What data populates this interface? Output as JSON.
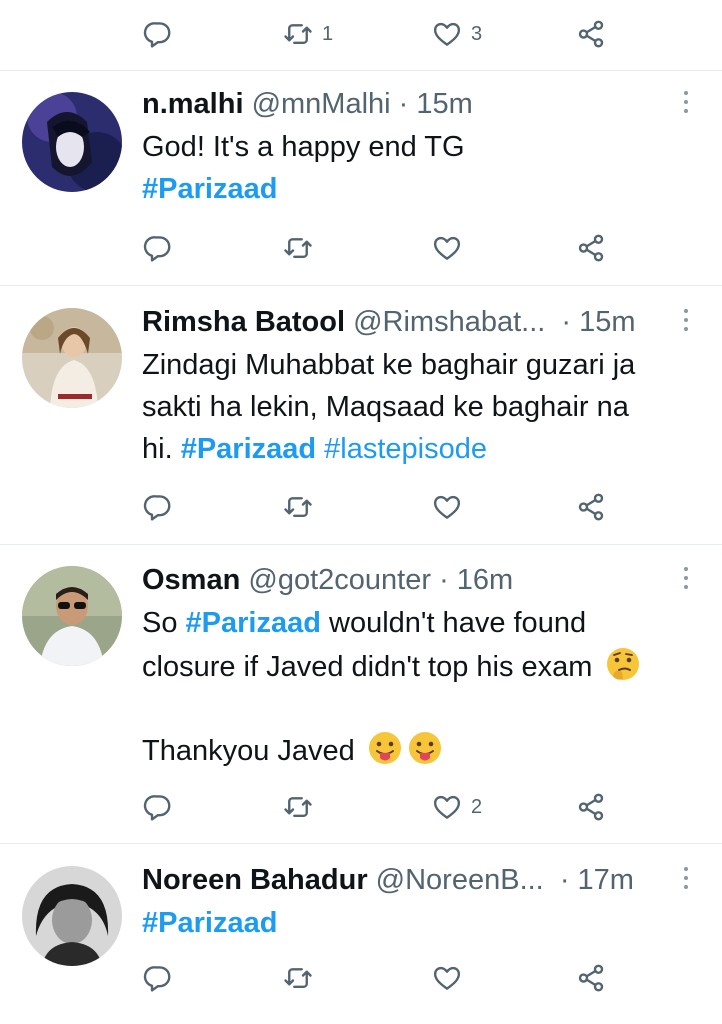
{
  "top_actions": {
    "retweets": "1",
    "likes": "3"
  },
  "tweets": [
    {
      "name": "n.malhi",
      "handle": "@mnMalhi",
      "dot": "·",
      "time": "15m",
      "text1": "God! It's a happy end TG",
      "hashtag1": "#Parizaad",
      "retweets": "",
      "likes": ""
    },
    {
      "name": "Rimsha Batool",
      "handle": "@Rimshabat...",
      "dot": "·",
      "time": "15m",
      "line1": "Zindagi Muhabbat ke baghair guzari ja",
      "line2": "sakti ha lekin, Maqsaad ke baghair na",
      "line3_pre": "hi. ",
      "hashtag1": "#Parizaad",
      "hashtag2": "#lastepisode"
    },
    {
      "name": "Osman",
      "handle": "@got2counter",
      "dot": "·",
      "time": "16m",
      "line1_pre": "So ",
      "hashtag1": "#Parizaad",
      "line1_post": " wouldn't have found",
      "line2": "closure if Javed didn't top his exam",
      "line3": "Thankyou Javed",
      "likes": "2"
    },
    {
      "name": "Noreen Bahadur",
      "handle": "@NoreenB...",
      "dot": "·",
      "time": "17m",
      "hashtag1": "#Parizaad"
    }
  ],
  "icons": {
    "reply": "reply-icon",
    "retweet": "retweet-icon",
    "like": "heart-icon",
    "share": "share-icon",
    "more": "more-icon"
  },
  "colors": {
    "hashtag": "#1d9bf0",
    "muted": "#536471",
    "text": "#0f1419",
    "divider": "#e6ecf0"
  }
}
